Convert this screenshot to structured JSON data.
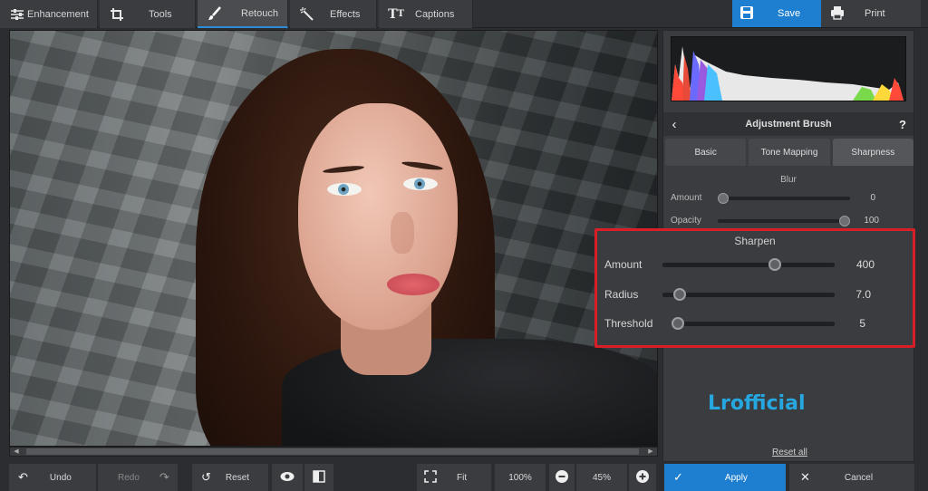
{
  "toolbar": {
    "tabs": [
      {
        "label": "Enhancement",
        "icon": "sliders-icon"
      },
      {
        "label": "Tools",
        "icon": "crop-icon"
      },
      {
        "label": "Retouch",
        "icon": "brush-icon"
      },
      {
        "label": "Effects",
        "icon": "magic-wand-icon"
      },
      {
        "label": "Captions",
        "icon": "text-icon"
      }
    ],
    "save_label": "Save",
    "print_label": "Print"
  },
  "panel": {
    "title": "Adjustment Brush",
    "help": "?",
    "subtabs": [
      "Basic",
      "Tone Mapping",
      "Sharpness"
    ],
    "active_subtab": "Sharpness",
    "blur": {
      "title": "Blur",
      "amount_label": "Amount",
      "amount_value": "0",
      "amount_level": 0,
      "opacity_label": "Opacity",
      "opacity_value": "100",
      "opacity_level": 1
    },
    "sharpen": {
      "title": "Sharpen",
      "amount_label": "Amount",
      "amount_value": "400",
      "amount_level": 0.65,
      "radius_label": "Radius",
      "radius_value": "7.0",
      "radius_level": 0.1,
      "threshold_label": "Threshold",
      "threshold_value": "5",
      "threshold_level": 0.03
    },
    "reset_all": "Reset all"
  },
  "watermark": "Lrofficial",
  "bottombar": {
    "undo": "Undo",
    "redo": "Redo",
    "reset": "Reset",
    "fit": "Fit",
    "zoom_100": "100%",
    "zoom_value": "45%",
    "apply": "Apply",
    "cancel": "Cancel"
  },
  "colors": {
    "accent": "#1e7fd0",
    "highlight_border": "#d81f28",
    "watermark": "#27a7e0"
  }
}
